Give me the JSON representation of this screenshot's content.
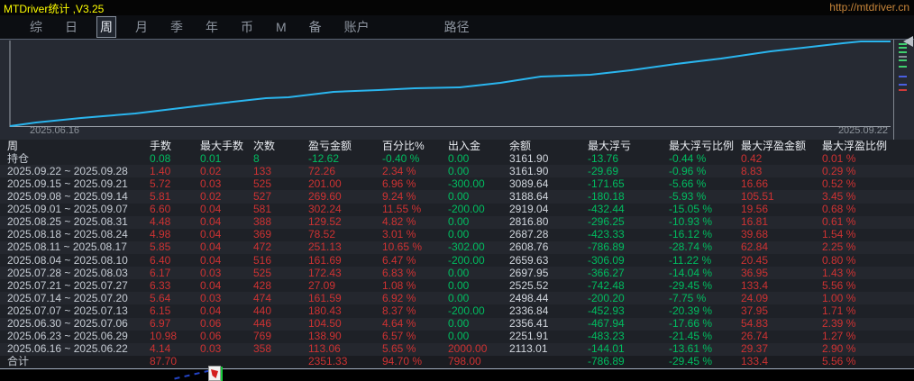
{
  "title_bar": {
    "title": "MTDriver统计 ,V3.25",
    "url": "http://mtdriver.cn"
  },
  "colors": {
    "title_yellow": "#ffff00",
    "url_orange": "#c8863a",
    "accent_cyan": "#2ab5ee",
    "gain_red": "#ce3232",
    "loss_green": "#00bd60",
    "chart_bg": "#262a33",
    "table_bg": "#1e2127"
  },
  "menu": {
    "items": [
      {
        "label": "综",
        "name": "menu-item-composite"
      },
      {
        "label": "日",
        "name": "menu-item-day"
      },
      {
        "label": "周",
        "name": "menu-item-week",
        "active": true
      },
      {
        "label": "月",
        "name": "menu-item-month"
      },
      {
        "label": "季",
        "name": "menu-item-quarter"
      },
      {
        "label": "年",
        "name": "menu-item-year"
      },
      {
        "label": "币",
        "name": "menu-item-currency"
      },
      {
        "label": "M",
        "name": "menu-item-m"
      },
      {
        "label": "备",
        "name": "menu-item-backup"
      },
      {
        "label": "账户",
        "name": "menu-item-account"
      },
      {
        "label": "路径",
        "name": "menu-item-path",
        "gap_before": true
      }
    ]
  },
  "chart": {
    "x_start_label": "2025.06.16",
    "x_end_label": "2025.09.22",
    "line_color": "#2ab5ee",
    "curve_points": [
      [
        11,
        96
      ],
      [
        40,
        92
      ],
      [
        90,
        87
      ],
      [
        150,
        82
      ],
      [
        200,
        76
      ],
      [
        250,
        70
      ],
      [
        295,
        65
      ],
      [
        320,
        64
      ],
      [
        370,
        58
      ],
      [
        420,
        56
      ],
      [
        460,
        54
      ],
      [
        510,
        53
      ],
      [
        555,
        48
      ],
      [
        600,
        41
      ],
      [
        655,
        39
      ],
      [
        700,
        34
      ],
      [
        750,
        27
      ],
      [
        800,
        21
      ],
      [
        855,
        13
      ],
      [
        900,
        8
      ],
      [
        935,
        4
      ],
      [
        955,
        2
      ],
      [
        988,
        2
      ]
    ],
    "mini_ticks": [
      {
        "y": 4,
        "color": "#3fcf6e"
      },
      {
        "y": 8,
        "color": "#3fcf6e"
      },
      {
        "y": 13,
        "color": "#3fcf6e"
      },
      {
        "y": 18,
        "color": "#8a9099"
      },
      {
        "y": 22,
        "color": "#3fcf6e"
      },
      {
        "y": 29,
        "color": "#3fcf6e"
      },
      {
        "y": 40,
        "color": "#4a5fe0"
      },
      {
        "y": 49,
        "color": "#4a5fe0"
      },
      {
        "y": 55,
        "color": "#d03a3a"
      }
    ]
  },
  "chart_data": {
    "type": "line",
    "title": "",
    "xlabel": "",
    "ylabel": "",
    "x": [
      "2025.06.22",
      "2025.06.29",
      "2025.07.06",
      "2025.07.13",
      "2025.07.20",
      "2025.07.27",
      "2025.08.03",
      "2025.08.10",
      "2025.08.17",
      "2025.08.24",
      "2025.08.31",
      "2025.09.07",
      "2025.09.14",
      "2025.09.21",
      "2025.09.28"
    ],
    "series": [
      {
        "name": "余额",
        "values": [
          2113.01,
          2251.91,
          2356.41,
          2336.84,
          2498.44,
          2525.52,
          2697.95,
          2659.63,
          2608.76,
          2687.28,
          2816.8,
          2919.04,
          3188.64,
          3089.64,
          3161.9
        ]
      }
    ],
    "x_range": [
      "2025.06.16",
      "2025.09.22"
    ],
    "grid": false,
    "legend": "none"
  },
  "table": {
    "columns": [
      "周",
      "手数",
      "最大手数",
      "次数",
      "盈亏金额",
      "百分比%",
      "出入金",
      "余额",
      "最大浮亏",
      "最大浮亏比例",
      "最大浮盈金额",
      "最大浮盈比例"
    ],
    "rows": [
      {
        "kind": "position",
        "cells": [
          [
            "持仓",
            "d"
          ],
          [
            "0.08",
            "g"
          ],
          [
            "0.01",
            "g"
          ],
          [
            "8",
            "g"
          ],
          [
            "-12.62",
            "g"
          ],
          [
            "-0.40 %",
            "g"
          ],
          [
            "0.00",
            "g"
          ],
          [
            "3161.90",
            "w"
          ],
          [
            "-13.76",
            "g"
          ],
          [
            "-0.44 %",
            "g"
          ],
          [
            "0.42",
            "r"
          ],
          [
            "0.01 %",
            "r"
          ]
        ]
      },
      {
        "kind": "week",
        "cells": [
          [
            "2025.09.22 ~ 2025.09.28",
            "d"
          ],
          [
            "1.40",
            "r"
          ],
          [
            "0.02",
            "r"
          ],
          [
            "133",
            "r"
          ],
          [
            "72.26",
            "r"
          ],
          [
            "2.34 %",
            "r"
          ],
          [
            "0.00",
            "g"
          ],
          [
            "3161.90",
            "w"
          ],
          [
            "-29.69",
            "g"
          ],
          [
            "-0.96 %",
            "g"
          ],
          [
            "8.83",
            "r"
          ],
          [
            "0.29 %",
            "r"
          ]
        ]
      },
      {
        "kind": "week",
        "cells": [
          [
            "2025.09.15 ~ 2025.09.21",
            "d"
          ],
          [
            "5.72",
            "r"
          ],
          [
            "0.03",
            "r"
          ],
          [
            "525",
            "r"
          ],
          [
            "201.00",
            "r"
          ],
          [
            "6.96 %",
            "r"
          ],
          [
            "-300.00",
            "g"
          ],
          [
            "3089.64",
            "w"
          ],
          [
            "-171.65",
            "g"
          ],
          [
            "-5.66 %",
            "g"
          ],
          [
            "16.66",
            "r"
          ],
          [
            "0.52 %",
            "r"
          ]
        ]
      },
      {
        "kind": "week",
        "cells": [
          [
            "2025.09.08 ~ 2025.09.14",
            "d"
          ],
          [
            "5.81",
            "r"
          ],
          [
            "0.02",
            "r"
          ],
          [
            "527",
            "r"
          ],
          [
            "269.60",
            "r"
          ],
          [
            "9.24 %",
            "r"
          ],
          [
            "0.00",
            "g"
          ],
          [
            "3188.64",
            "w"
          ],
          [
            "-180.18",
            "g"
          ],
          [
            "-5.93 %",
            "g"
          ],
          [
            "105.51",
            "r"
          ],
          [
            "3.45 %",
            "r"
          ]
        ]
      },
      {
        "kind": "week",
        "cells": [
          [
            "2025.09.01 ~ 2025.09.07",
            "d"
          ],
          [
            "6.60",
            "r"
          ],
          [
            "0.04",
            "r"
          ],
          [
            "581",
            "r"
          ],
          [
            "302.24",
            "r"
          ],
          [
            "11.55 %",
            "r"
          ],
          [
            "-200.00",
            "g"
          ],
          [
            "2919.04",
            "w"
          ],
          [
            "-432.44",
            "g"
          ],
          [
            "-15.05 %",
            "g"
          ],
          [
            "19.56",
            "r"
          ],
          [
            "0.68 %",
            "r"
          ]
        ]
      },
      {
        "kind": "week",
        "cells": [
          [
            "2025.08.25 ~ 2025.08.31",
            "d"
          ],
          [
            "4.48",
            "r"
          ],
          [
            "0.04",
            "r"
          ],
          [
            "388",
            "r"
          ],
          [
            "129.52",
            "r"
          ],
          [
            "4.82 %",
            "r"
          ],
          [
            "0.00",
            "g"
          ],
          [
            "2816.80",
            "w"
          ],
          [
            "-296.25",
            "g"
          ],
          [
            "-10.93 %",
            "g"
          ],
          [
            "16.81",
            "r"
          ],
          [
            "0.61 %",
            "r"
          ]
        ]
      },
      {
        "kind": "week",
        "cells": [
          [
            "2025.08.18 ~ 2025.08.24",
            "d"
          ],
          [
            "4.98",
            "r"
          ],
          [
            "0.04",
            "r"
          ],
          [
            "369",
            "r"
          ],
          [
            "78.52",
            "r"
          ],
          [
            "3.01 %",
            "r"
          ],
          [
            "0.00",
            "g"
          ],
          [
            "2687.28",
            "w"
          ],
          [
            "-423.33",
            "g"
          ],
          [
            "-16.12 %",
            "g"
          ],
          [
            "39.68",
            "r"
          ],
          [
            "1.54 %",
            "r"
          ]
        ]
      },
      {
        "kind": "week",
        "cells": [
          [
            "2025.08.11 ~ 2025.08.17",
            "d"
          ],
          [
            "5.85",
            "r"
          ],
          [
            "0.04",
            "r"
          ],
          [
            "472",
            "r"
          ],
          [
            "251.13",
            "r"
          ],
          [
            "10.65 %",
            "r"
          ],
          [
            "-302.00",
            "g"
          ],
          [
            "2608.76",
            "w"
          ],
          [
            "-786.89",
            "g"
          ],
          [
            "-28.74 %",
            "g"
          ],
          [
            "62.84",
            "r"
          ],
          [
            "2.25 %",
            "r"
          ]
        ]
      },
      {
        "kind": "week",
        "cells": [
          [
            "2025.08.04 ~ 2025.08.10",
            "d"
          ],
          [
            "6.40",
            "r"
          ],
          [
            "0.04",
            "r"
          ],
          [
            "516",
            "r"
          ],
          [
            "161.69",
            "r"
          ],
          [
            "6.47 %",
            "r"
          ],
          [
            "-200.00",
            "g"
          ],
          [
            "2659.63",
            "w"
          ],
          [
            "-306.09",
            "g"
          ],
          [
            "-11.22 %",
            "g"
          ],
          [
            "20.45",
            "r"
          ],
          [
            "0.80 %",
            "r"
          ]
        ]
      },
      {
        "kind": "week",
        "cells": [
          [
            "2025.07.28 ~ 2025.08.03",
            "d"
          ],
          [
            "6.17",
            "r"
          ],
          [
            "0.03",
            "r"
          ],
          [
            "525",
            "r"
          ],
          [
            "172.43",
            "r"
          ],
          [
            "6.83 %",
            "r"
          ],
          [
            "0.00",
            "g"
          ],
          [
            "2697.95",
            "w"
          ],
          [
            "-366.27",
            "g"
          ],
          [
            "-14.04 %",
            "g"
          ],
          [
            "36.95",
            "r"
          ],
          [
            "1.43 %",
            "r"
          ]
        ]
      },
      {
        "kind": "week",
        "cells": [
          [
            "2025.07.21 ~ 2025.07.27",
            "d"
          ],
          [
            "6.33",
            "r"
          ],
          [
            "0.04",
            "r"
          ],
          [
            "428",
            "r"
          ],
          [
            "27.09",
            "r"
          ],
          [
            "1.08 %",
            "r"
          ],
          [
            "0.00",
            "g"
          ],
          [
            "2525.52",
            "w"
          ],
          [
            "-742.48",
            "g"
          ],
          [
            "-29.45 %",
            "g"
          ],
          [
            "133.4",
            "r"
          ],
          [
            "5.56 %",
            "r"
          ]
        ]
      },
      {
        "kind": "week",
        "cells": [
          [
            "2025.07.14 ~ 2025.07.20",
            "d"
          ],
          [
            "5.64",
            "r"
          ],
          [
            "0.03",
            "r"
          ],
          [
            "474",
            "r"
          ],
          [
            "161.59",
            "r"
          ],
          [
            "6.92 %",
            "r"
          ],
          [
            "0.00",
            "g"
          ],
          [
            "2498.44",
            "w"
          ],
          [
            "-200.20",
            "g"
          ],
          [
            "-7.75 %",
            "g"
          ],
          [
            "24.09",
            "r"
          ],
          [
            "1.00 %",
            "r"
          ]
        ]
      },
      {
        "kind": "week",
        "cells": [
          [
            "2025.07.07 ~ 2025.07.13",
            "d"
          ],
          [
            "6.15",
            "r"
          ],
          [
            "0.04",
            "r"
          ],
          [
            "440",
            "r"
          ],
          [
            "180.43",
            "r"
          ],
          [
            "8.37 %",
            "r"
          ],
          [
            "-200.00",
            "g"
          ],
          [
            "2336.84",
            "w"
          ],
          [
            "-452.93",
            "g"
          ],
          [
            "-20.39 %",
            "g"
          ],
          [
            "37.95",
            "r"
          ],
          [
            "1.71 %",
            "r"
          ]
        ]
      },
      {
        "kind": "week",
        "cells": [
          [
            "2025.06.30 ~ 2025.07.06",
            "d"
          ],
          [
            "6.97",
            "r"
          ],
          [
            "0.06",
            "r"
          ],
          [
            "446",
            "r"
          ],
          [
            "104.50",
            "r"
          ],
          [
            "4.64 %",
            "r"
          ],
          [
            "0.00",
            "g"
          ],
          [
            "2356.41",
            "w"
          ],
          [
            "-467.94",
            "g"
          ],
          [
            "-17.66 %",
            "g"
          ],
          [
            "54.83",
            "r"
          ],
          [
            "2.39 %",
            "r"
          ]
        ]
      },
      {
        "kind": "week",
        "cells": [
          [
            "2025.06.23 ~ 2025.06.29",
            "d"
          ],
          [
            "10.98",
            "r"
          ],
          [
            "0.06",
            "r"
          ],
          [
            "769",
            "r"
          ],
          [
            "138.90",
            "r"
          ],
          [
            "6.57 %",
            "r"
          ],
          [
            "0.00",
            "g"
          ],
          [
            "2251.91",
            "w"
          ],
          [
            "-483.23",
            "g"
          ],
          [
            "-21.45 %",
            "g"
          ],
          [
            "26.74",
            "r"
          ],
          [
            "1.27 %",
            "r"
          ]
        ]
      },
      {
        "kind": "week",
        "cells": [
          [
            "2025.06.16 ~ 2025.06.22",
            "d"
          ],
          [
            "4.14",
            "r"
          ],
          [
            "0.03",
            "r"
          ],
          [
            "358",
            "r"
          ],
          [
            "113.06",
            "r"
          ],
          [
            "5.65 %",
            "r"
          ],
          [
            "2000.00",
            "r"
          ],
          [
            "2113.01",
            "w"
          ],
          [
            "-144.01",
            "g"
          ],
          [
            "-13.61 %",
            "g"
          ],
          [
            "29.37",
            "r"
          ],
          [
            "2.90 %",
            "r"
          ]
        ]
      },
      {
        "kind": "total",
        "cells": [
          [
            "合计",
            "d"
          ],
          [
            "87.70",
            "r"
          ],
          [
            "",
            ""
          ],
          [
            "",
            ""
          ],
          [
            "2351.33",
            "r"
          ],
          [
            "94.70 %",
            "r"
          ],
          [
            "798.00",
            "r"
          ],
          [
            "",
            ""
          ],
          [
            "-786.89",
            "g"
          ],
          [
            "-29.45 %",
            "g"
          ],
          [
            "133.4",
            "r"
          ],
          [
            "5.56 %",
            "r"
          ]
        ]
      }
    ]
  }
}
